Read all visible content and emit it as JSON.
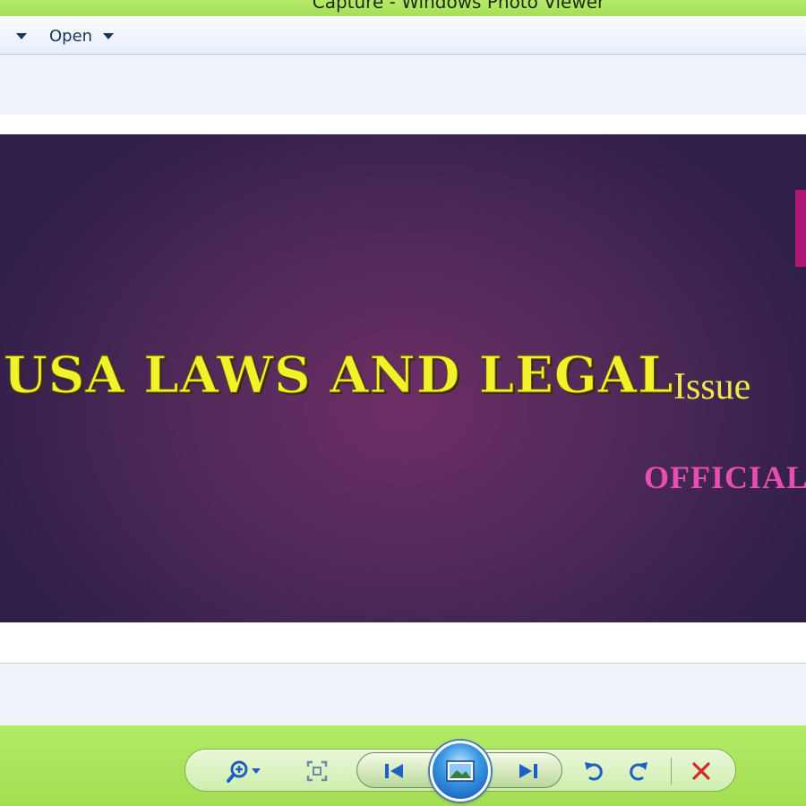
{
  "window": {
    "title": "Capture - Windows Photo Viewer"
  },
  "menubar": {
    "open_label": "Open"
  },
  "photo": {
    "title": "USA LAWS AND LEGAL",
    "title_suffix": "Issue",
    "subtitle": "OFFICIAL",
    "title_color": "#f2f22a",
    "subtitle_color": "#e64fb0",
    "accent_tab_color": "#b01673"
  },
  "controls": {
    "icons": [
      "zoom-icon",
      "actual-size-icon",
      "previous-icon",
      "slideshow-icon",
      "next-icon",
      "rotate-left-icon",
      "rotate-right-icon",
      "delete-icon"
    ],
    "icon_color": "#1d5fc4",
    "delete_color": "#d8262b"
  }
}
